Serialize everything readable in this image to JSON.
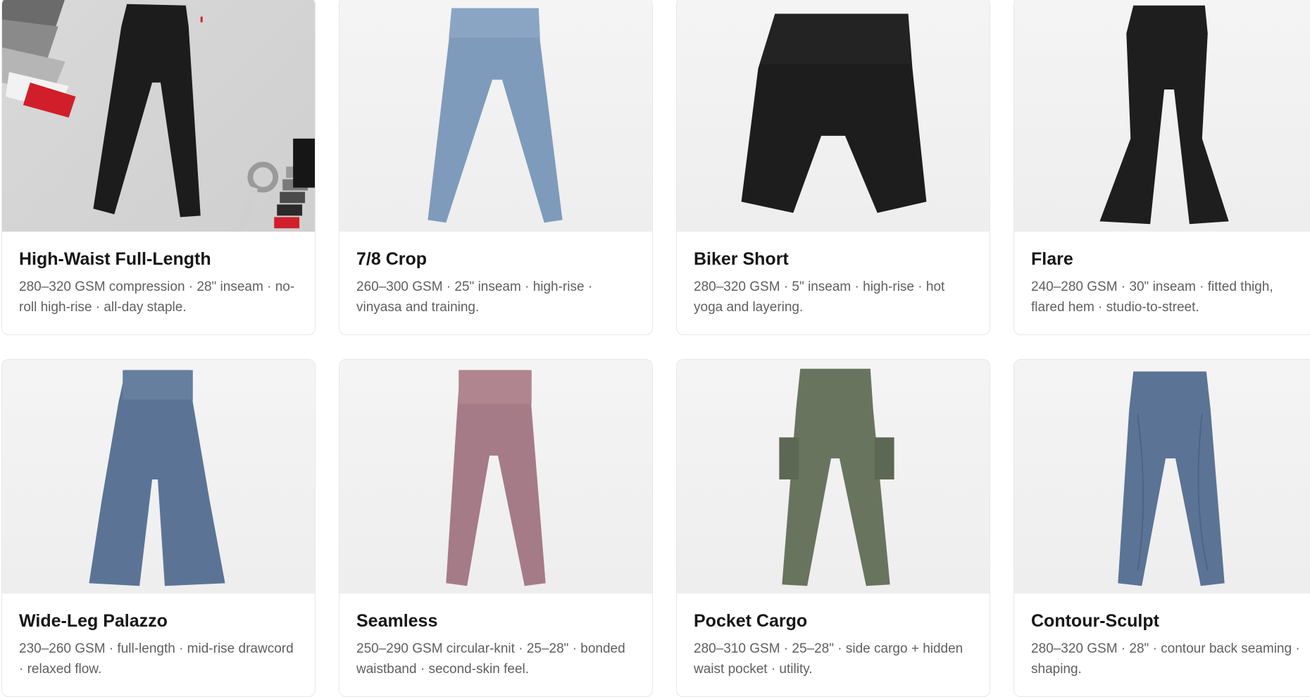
{
  "products": [
    {
      "name": "High-Waist Full-Length",
      "description": "280–320 GSM compression · 28\" inseam · no-roll high-rise · all-day staple.",
      "color": "#1c1c1c"
    },
    {
      "name": "7/8 Crop",
      "description": "260–300 GSM · 25\" inseam · high-rise · vinyasa and training.",
      "color": "#7f9bbb"
    },
    {
      "name": "Biker Short",
      "description": "280–320 GSM · 5\" inseam · high-rise · hot yoga and layering.",
      "color": "#1d1d1d"
    },
    {
      "name": "Flare",
      "description": "240–280 GSM · 30\" inseam · fitted thigh, flared hem · studio-to-street.",
      "color": "#1e1e1e"
    },
    {
      "name": "Wide-Leg Palazzo",
      "description": "230–260 GSM · full-length · mid-rise drawcord · relaxed flow.",
      "color": "#5b7496"
    },
    {
      "name": "Seamless",
      "description": "250–290 GSM circular-knit · 25–28\" · bonded waistband · second-skin feel.",
      "color": "#a57b87"
    },
    {
      "name": "Pocket Cargo",
      "description": "280–310 GSM · 25–28\" · side cargo + hidden waist pocket · utility.",
      "color": "#69745f"
    },
    {
      "name": "Contour-Sculpt",
      "description": "280–320 GSM · 28\" · contour back seaming · shaping.",
      "color": "#5b7394"
    }
  ]
}
